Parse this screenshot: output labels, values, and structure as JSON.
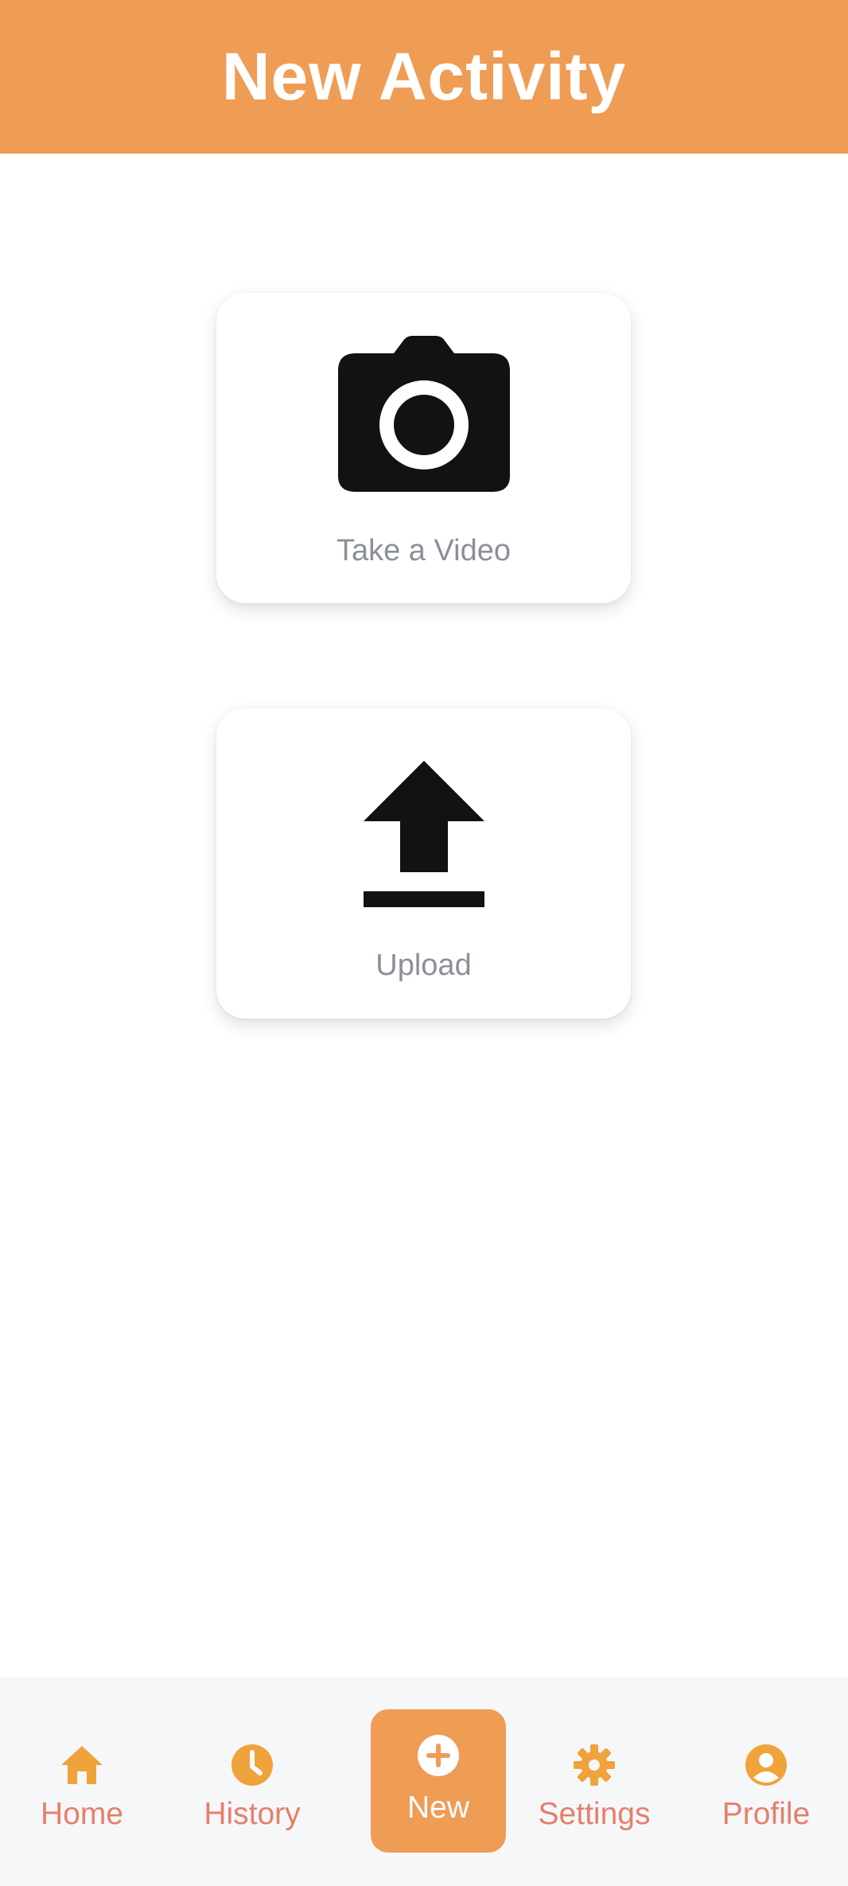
{
  "header": {
    "title": "New Activity"
  },
  "actions": [
    {
      "label": "Take a Video",
      "icon": "camera-icon"
    },
    {
      "label": "Upload",
      "icon": "upload-icon"
    }
  ],
  "tabbar": {
    "items": [
      {
        "label": "Home",
        "icon": "home-icon",
        "active": false
      },
      {
        "label": "History",
        "icon": "clock-icon",
        "active": false
      },
      {
        "label": "New",
        "icon": "plus-circle-icon",
        "active": true
      },
      {
        "label": "Settings",
        "icon": "gear-icon",
        "active": false
      },
      {
        "label": "Profile",
        "icon": "user-circle-icon",
        "active": false
      }
    ]
  },
  "colors": {
    "accent": "#EF9C55",
    "tab_label": "#E57F6C",
    "tab_icon": "#F0A23B",
    "card_label": "#8B8F98",
    "tabbar_bg": "#F6F7F9"
  }
}
